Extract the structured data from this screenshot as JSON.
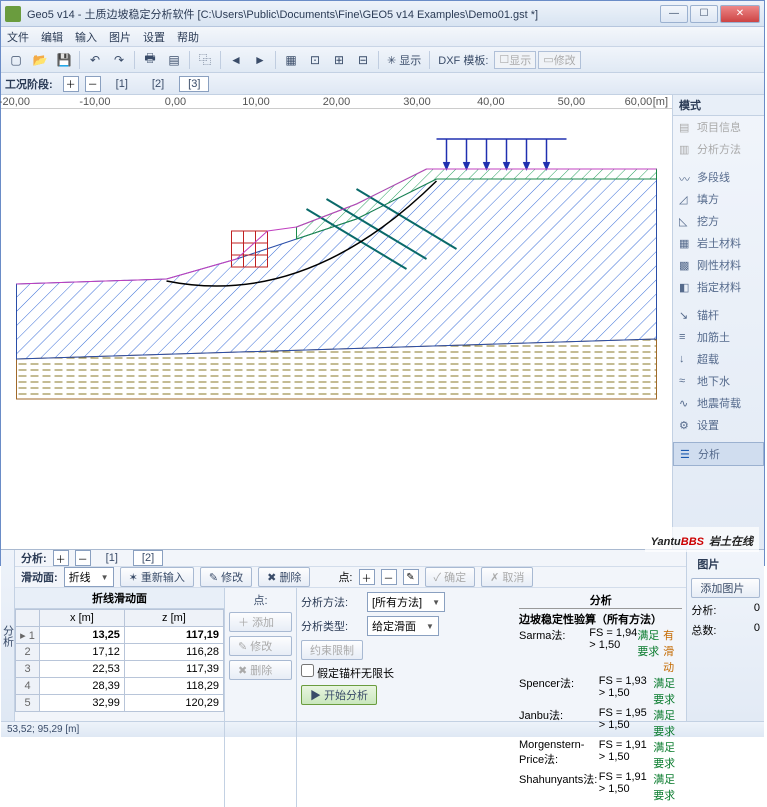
{
  "title": "Geo5 v14 - 土质边坡稳定分析软件 [C:\\Users\\Public\\Documents\\Fine\\GEO5 v14 Examples\\Demo01.gst *]",
  "menu": {
    "file": "文件",
    "edit": "编辑",
    "input": "输入",
    "pic": "图片",
    "set": "设置",
    "help": "帮助"
  },
  "toolbar": {
    "dxf": "DXF 模板:",
    "show": "显示",
    "mod": "修改",
    "xian": "显示"
  },
  "stage": {
    "label": "工况阶段:",
    "t1": "[1]",
    "t2": "[2]",
    "t3": "[3]"
  },
  "ruler": {
    "m20": "-20,00",
    "m10": "-10,00",
    "z": "0,00",
    "p10": "10,00",
    "p20": "20,00",
    "p30": "30,00",
    "p40": "40,00",
    "p50": "50,00",
    "p60": "60,00",
    "unit": "[m]"
  },
  "mode": {
    "head": "模式",
    "proj": "项目信息",
    "meth": "分析方法",
    "poly": "多段线",
    "embank": "填方",
    "cut": "挖方",
    "soil": "岩土材料",
    "rigid": "刚性材料",
    "assign": "指定材料",
    "anchor": "锚杆",
    "reinf": "加筋土",
    "surch": "超载",
    "water": "地下水",
    "quake": "地震荷载",
    "setting": "设置",
    "analysis": "分析"
  },
  "analysis": {
    "label": "分析:",
    "t1": "[1]",
    "t2": "[2]",
    "slide": "滑动面:",
    "polyline": "折线",
    "reinput": "重新输入",
    "modify": "修改",
    "delete": "删除",
    "point": "点:",
    "confirm": "确定",
    "cancel": "取消"
  },
  "table": {
    "header": "折线滑动面",
    "x": "x [m]",
    "z": "z [m]",
    "rows": [
      {
        "n": "1",
        "x": "13,25",
        "z": "117,19"
      },
      {
        "n": "2",
        "x": "17,12",
        "z": "116,28"
      },
      {
        "n": "3",
        "x": "22,53",
        "z": "117,39"
      },
      {
        "n": "4",
        "x": "28,39",
        "z": "118,29"
      },
      {
        "n": "5",
        "x": "32,99",
        "z": "120,29"
      }
    ]
  },
  "midbtns": {
    "pt": "点:",
    "add": "添加",
    "edit": "修改",
    "del": "删除"
  },
  "method": {
    "mlabel": "分析方法:",
    "mval": "[所有方法]",
    "tlabel": "分析类型:",
    "tval": "给定滑面",
    "constr": "约束限制",
    "infinite": "假定锚杆无限长",
    "start": "开始分析"
  },
  "res": {
    "head": "分析",
    "sub": "边坡稳定性验算（所有方法）",
    "lines": [
      {
        "m": "Sarma法:",
        "f": "FS = 1,94 > 1,50",
        "s": "满足要求",
        "w": "有滑动"
      },
      {
        "m": "Spencer法:",
        "f": "FS = 1,93 > 1,50",
        "s": "满足要求",
        "w": ""
      },
      {
        "m": "Janbu法:",
        "f": "FS = 1,95 > 1,50",
        "s": "满足要求",
        "w": ""
      },
      {
        "m": "Morgenstern-Price法:",
        "f": "FS = 1,91 > 1,50",
        "s": "满足要求",
        "w": ""
      },
      {
        "m": "Shahunyants法:",
        "f": "FS = 1,91 > 1,50",
        "s": "满足要求",
        "w": ""
      }
    ]
  },
  "pic": {
    "head": "图片",
    "add": "添加图片",
    "a": "分析:",
    "av": "0",
    "t": "总数:",
    "tv": "0"
  },
  "status": "53,52; 95,29 [m]",
  "wm": {
    "a": "Yantu",
    "b": "BBS",
    "c": "岩土在线"
  }
}
